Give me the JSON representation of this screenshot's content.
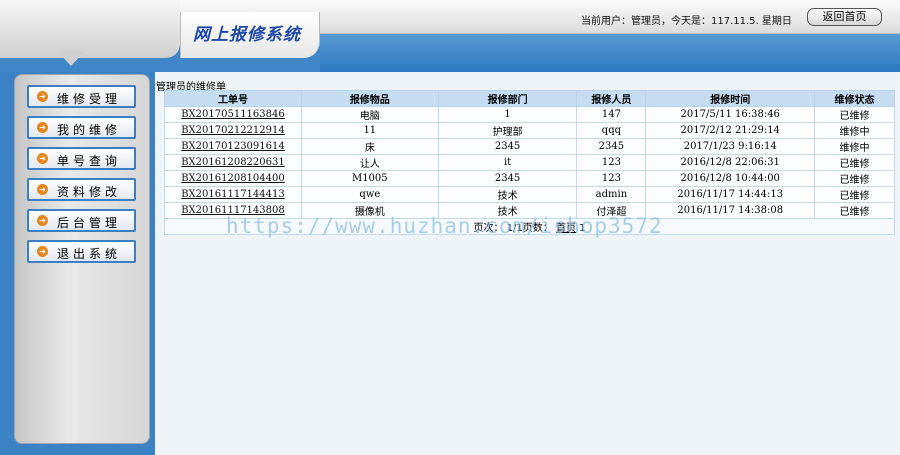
{
  "header": {
    "system_title": "网上报修系统",
    "user_info": "当前用户：管理员，今天是：117.11.5. 星期日",
    "back_home": "返回首页"
  },
  "sidebar": {
    "items": [
      {
        "label": "维修受理"
      },
      {
        "label": "我的维修"
      },
      {
        "label": "单号查询"
      },
      {
        "label": "资料修改"
      },
      {
        "label": "后台管理"
      },
      {
        "label": "退出系统"
      }
    ]
  },
  "main": {
    "caption": "管理员的维修单",
    "columns": [
      "工单号",
      "报修物品",
      "报修部门",
      "报修人员",
      "报修时间",
      "维修状态"
    ],
    "rows": [
      [
        "BX20170511163846",
        "电脑",
        "1",
        "147",
        "2017/5/11 16:38:46",
        "已维修"
      ],
      [
        "BX20170212212914",
        "11",
        "护理部",
        "qqq",
        "2017/2/12 21:29:14",
        "维修中"
      ],
      [
        "BX20170123091614",
        "床",
        "2345",
        "2345",
        "2017/1/23 9:16:14",
        "维修中"
      ],
      [
        "BX20161208220631",
        "让人",
        "it",
        "123",
        "2016/12/8 22:06:31",
        "已维修"
      ],
      [
        "BX20161208104400",
        "M1005",
        "2345",
        "123",
        "2016/12/8 10:44:00",
        "已维修"
      ],
      [
        "BX20161117144413",
        "qwe",
        "技术",
        "admin",
        "2016/11/17 14:44:13",
        "已维修"
      ],
      [
        "BX20161117143808",
        "摄像机",
        "技术",
        "付泽超",
        "2016/11/17 14:38:08",
        "已维修"
      ]
    ],
    "pager": {
      "prefix": "页次： 1/1页数：",
      "home": "首页",
      "page": " 1"
    }
  },
  "watermark": "https://www.huzhan.com/ishop3572",
  "colors": {
    "header_blue": "#3f86c8",
    "menu_border": "#3a7fc4",
    "menu_icon": "#e5871e",
    "table_header": "#c6ddf1"
  },
  "icons": {
    "menu_item": "orange-arrow-circle-icon"
  }
}
